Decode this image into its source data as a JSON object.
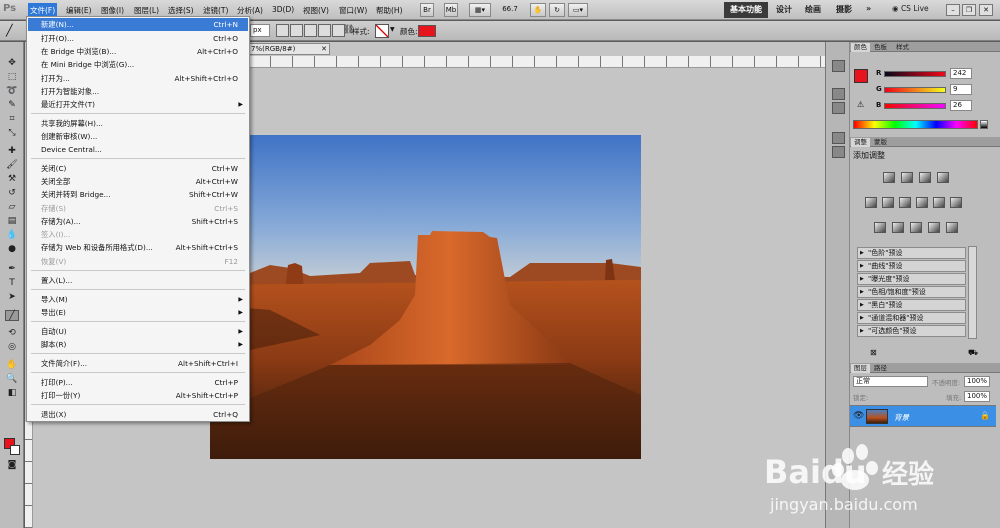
{
  "app": {
    "logo": "Ps"
  },
  "menubar": {
    "items": [
      "文件(F)",
      "编辑(E)",
      "图像(I)",
      "图层(L)",
      "选择(S)",
      "滤镜(T)",
      "分析(A)",
      "3D(D)",
      "视图(V)",
      "窗口(W)",
      "帮助(H)"
    ],
    "zoom": "66.7",
    "workspaces": [
      "基本功能",
      "设计",
      "绘画",
      "摄影"
    ],
    "cs_live": "CS Live"
  },
  "options": {
    "width_unit": "px",
    "style_label": "样式:",
    "color_label": "颜色:"
  },
  "document": {
    "tab_label": "7%(RGB/8#)"
  },
  "file_menu": {
    "items": [
      {
        "label": "新建(N)...",
        "shortcut": "Ctrl+N",
        "state": "highlight"
      },
      {
        "label": "打开(O)...",
        "shortcut": "Ctrl+O"
      },
      {
        "label": "在 Bridge 中浏览(B)...",
        "shortcut": "Alt+Ctrl+O"
      },
      {
        "label": "在 Mini Bridge 中浏览(G)...",
        "shortcut": ""
      },
      {
        "label": "打开为...",
        "shortcut": "Alt+Shift+Ctrl+O"
      },
      {
        "label": "打开为智能对象...",
        "shortcut": ""
      },
      {
        "label": "最近打开文件(T)",
        "shortcut": "",
        "submenu": true
      },
      {
        "label": "共享我的屏幕(H)...",
        "shortcut": ""
      },
      {
        "label": "创建新审核(W)...",
        "shortcut": ""
      },
      {
        "label": "Device Central...",
        "shortcut": ""
      },
      {
        "label": "关闭(C)",
        "shortcut": "Ctrl+W"
      },
      {
        "label": "关闭全部",
        "shortcut": "Alt+Ctrl+W"
      },
      {
        "label": "关闭并转到 Bridge...",
        "shortcut": "Shift+Ctrl+W"
      },
      {
        "label": "存储(S)",
        "shortcut": "Ctrl+S",
        "state": "disabled"
      },
      {
        "label": "存储为(A)...",
        "shortcut": "Shift+Ctrl+S"
      },
      {
        "label": "签入(I)...",
        "shortcut": "",
        "state": "disabled"
      },
      {
        "label": "存储为 Web 和设备所用格式(D)...",
        "shortcut": "Alt+Shift+Ctrl+S"
      },
      {
        "label": "恢复(V)",
        "shortcut": "F12",
        "state": "disabled"
      },
      {
        "label": "置入(L)...",
        "shortcut": ""
      },
      {
        "label": "导入(M)",
        "shortcut": "",
        "submenu": true
      },
      {
        "label": "导出(E)",
        "shortcut": "",
        "submenu": true
      },
      {
        "label": "自动(U)",
        "shortcut": "",
        "submenu": true
      },
      {
        "label": "脚本(R)",
        "shortcut": "",
        "submenu": true
      },
      {
        "label": "文件简介(F)...",
        "shortcut": "Alt+Shift+Ctrl+I"
      },
      {
        "label": "打印(P)...",
        "shortcut": "Ctrl+P"
      },
      {
        "label": "打印一份(Y)",
        "shortcut": "Alt+Shift+Ctrl+P"
      },
      {
        "label": "退出(X)",
        "shortcut": "Ctrl+Q"
      }
    ]
  },
  "color_panel": {
    "tabs": [
      "颜色",
      "色板",
      "样式"
    ],
    "r_label": "R",
    "r": "242",
    "g_label": "G",
    "g": "9",
    "b_label": "B",
    "b": "26",
    "fg_hex": "#f2091a"
  },
  "adjustments": {
    "tabs": [
      "调整",
      "蒙版"
    ],
    "title": "添加调整",
    "presets": [
      "\"色阶\"预设",
      "\"曲线\"预设",
      "\"曝光度\"预设",
      "\"色相/饱和度\"预设",
      "\"黑白\"预设",
      "\"通道混和器\"预设",
      "\"可选颜色\"预设"
    ]
  },
  "layers": {
    "tabs": [
      "图层",
      "路径"
    ],
    "blend_mode": "正常",
    "opacity_label": "不透明度:",
    "opacity": "100%",
    "lock_label": "锁定:",
    "fill_label": "填充:",
    "fill": "100%",
    "layer_name": "背景"
  },
  "watermark": {
    "brand": "Baidu",
    "brand_cn": "经验",
    "url": "jingyan.baidu.com"
  }
}
